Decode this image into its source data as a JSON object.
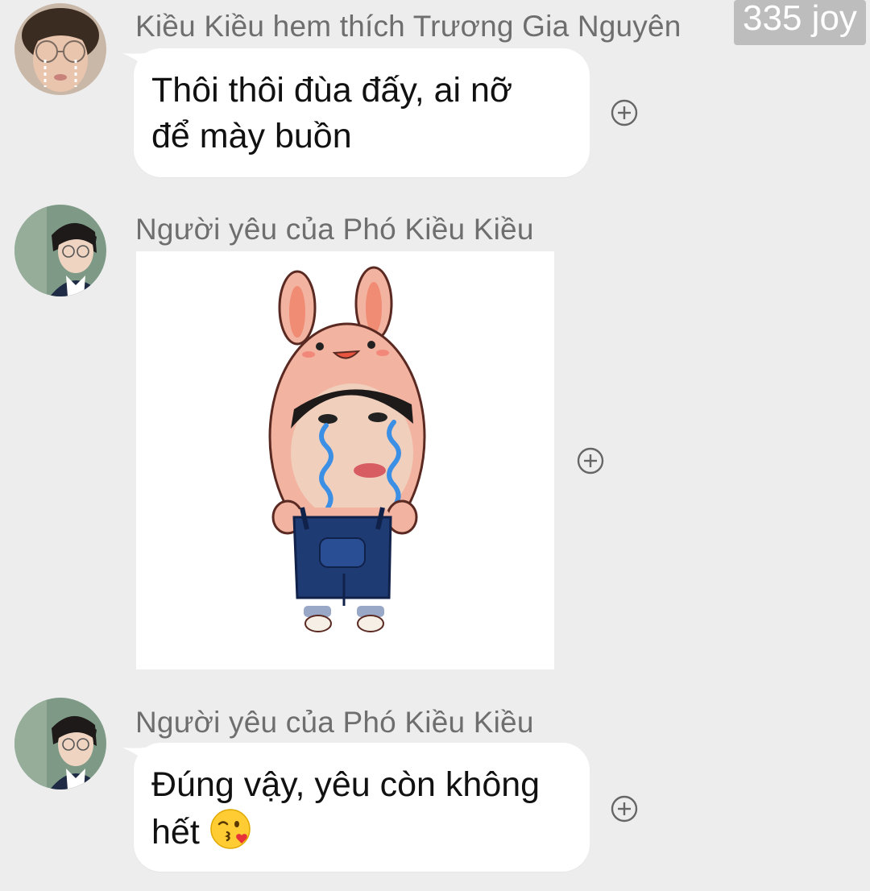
{
  "badge": "335 joy",
  "messages": [
    {
      "sender": "Kiều Kiều hem thích Trương Gia Nguyên",
      "text_line1": "Thôi thôi đùa đấy, ai nỡ",
      "text_line2": "để mày buồn"
    },
    {
      "sender": "Người yêu của Phó Kiều Kiều",
      "sticker": "crying-bunny-sticker"
    },
    {
      "sender": "Người yêu của Phó Kiều Kiều",
      "text_line1": "Đúng vậy, yêu còn không",
      "text_line2": "hết",
      "emoji": "kissing-face-emoji"
    }
  ],
  "colors": {
    "background": "#ededed",
    "bubble": "#ffffff",
    "sender_text": "#6e6e6e",
    "badge": "#bdbdbd"
  }
}
